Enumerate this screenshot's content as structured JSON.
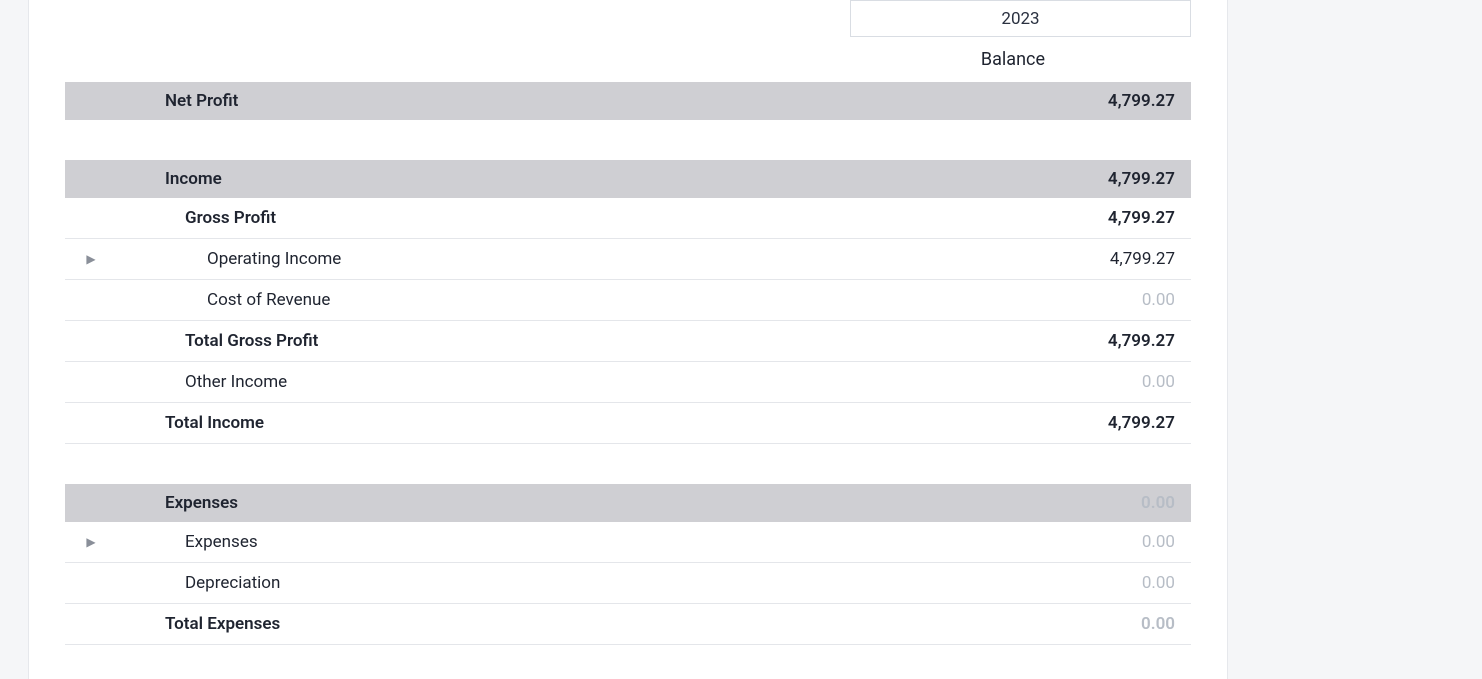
{
  "header": {
    "year": "2023",
    "balance_label": "Balance"
  },
  "net_profit": {
    "label": "Net Profit",
    "value": "4,799.27"
  },
  "income": {
    "header": {
      "label": "Income",
      "value": "4,799.27"
    },
    "gross_profit": {
      "label": "Gross Profit",
      "value": "4,799.27"
    },
    "operating_income": {
      "label": "Operating Income",
      "value": "4,799.27"
    },
    "cost_of_revenue": {
      "label": "Cost of Revenue",
      "value": "0.00"
    },
    "total_gross_profit": {
      "label": "Total Gross Profit",
      "value": "4,799.27"
    },
    "other_income": {
      "label": "Other Income",
      "value": "0.00"
    },
    "total_income": {
      "label": "Total Income",
      "value": "4,799.27"
    }
  },
  "expenses": {
    "header": {
      "label": "Expenses",
      "value": "0.00"
    },
    "expenses_row": {
      "label": "Expenses",
      "value": "0.00"
    },
    "depreciation": {
      "label": "Depreciation",
      "value": "0.00"
    },
    "total_expenses": {
      "label": "Total Expenses",
      "value": "0.00"
    }
  }
}
